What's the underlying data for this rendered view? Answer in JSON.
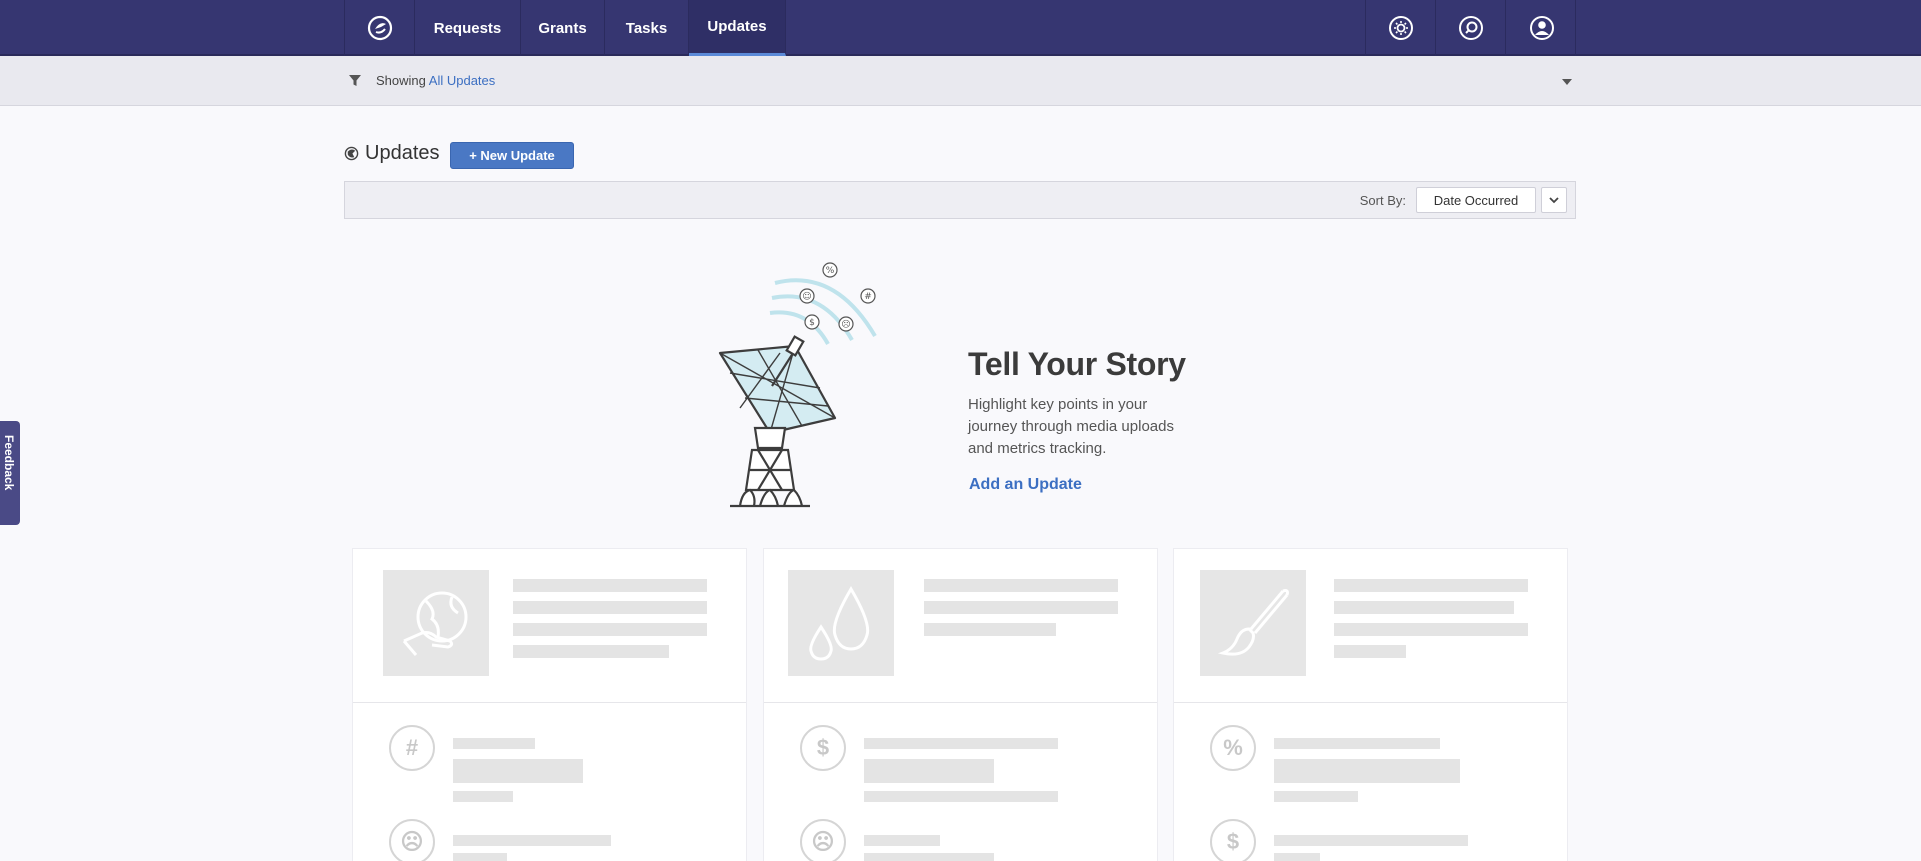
{
  "nav": {
    "items": [
      {
        "label": "Requests"
      },
      {
        "label": "Grants"
      },
      {
        "label": "Tasks"
      },
      {
        "label": "Updates"
      }
    ],
    "active": "Updates",
    "icons": [
      "settings-gear-icon",
      "search-icon",
      "user-account-icon"
    ]
  },
  "filter": {
    "prefix": "Showing",
    "value": "All Updates"
  },
  "header": {
    "title": "Updates",
    "new_button": "+ New Update"
  },
  "sort": {
    "label": "Sort By:",
    "selected": "Date Occurred"
  },
  "empty_state": {
    "title": "Tell Your Story",
    "text": "Highlight key points in your journey through media uploads and metrics tracking.",
    "link": "Add an Update"
  },
  "feedback": {
    "label": "Feedback"
  },
  "colors": {
    "nav_bg": "#363671",
    "accent": "#4a78c4",
    "link": "#3c6fc2"
  }
}
